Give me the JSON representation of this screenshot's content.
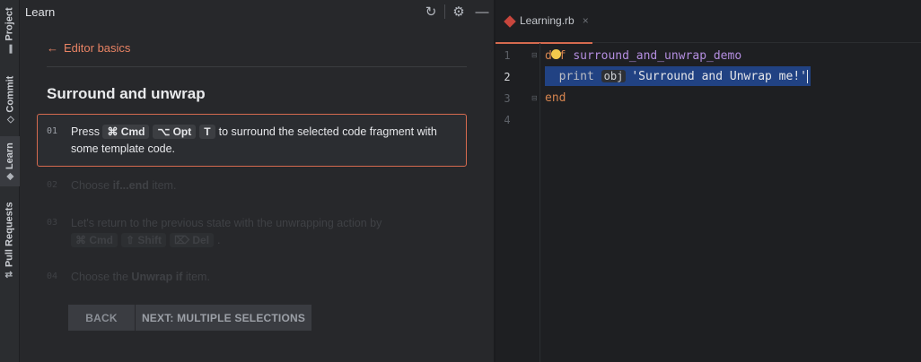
{
  "sidebar": {
    "tabs": [
      {
        "label": "Project",
        "icon": "folder-icon"
      },
      {
        "label": "Commit",
        "icon": "commit-icon"
      },
      {
        "label": "Learn",
        "icon": "graduation-icon"
      },
      {
        "label": "Pull Requests",
        "icon": "pull-request-icon"
      }
    ]
  },
  "learn": {
    "header": "Learn",
    "back_label": "Editor basics",
    "title": "Surround and unwrap",
    "steps": [
      {
        "num": "01",
        "pre": "Press",
        "keys": [
          "⌘ Cmd",
          "⌥ Opt",
          "T"
        ],
        "post": "to surround the selected code fragment with some template code."
      },
      {
        "num": "02",
        "pre": "Choose",
        "bold": "if...end",
        "post": "item."
      },
      {
        "num": "03",
        "text": "Let's return to the previous state with the unwrapping action by",
        "keys": [
          "⌘ Cmd",
          "⇧ Shift",
          "⌦ Del"
        ],
        "post": "."
      },
      {
        "num": "04",
        "pre": "Choose the",
        "bold": "Unwrap if",
        "post": "item."
      }
    ],
    "buttons": {
      "back": "BACK",
      "next": "NEXT: MULTIPLE SELECTIONS"
    }
  },
  "editor": {
    "tab_label": "Learning.rb",
    "close_glyph": "×",
    "line_numbers": [
      "1",
      "2",
      "3",
      "4"
    ],
    "code": {
      "line1_kw": "def",
      "line1_fn": "surround_and_unwrap_demo",
      "line2_print": "print",
      "line2_hint": "obj",
      "line2_str": "'Surround and Unwrap me!'",
      "line3_kw": "end"
    }
  },
  "colors": {
    "accent": "#d56a4f",
    "keyword": "#d5844f",
    "function": "#b48ee0",
    "selection": "#214283"
  }
}
